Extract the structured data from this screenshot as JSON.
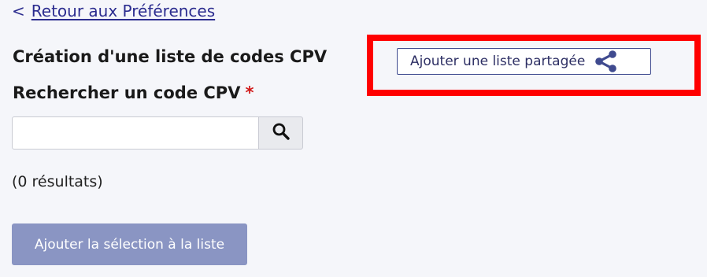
{
  "nav": {
    "back_chevron": "<",
    "back_label": "Retour aux Préférences"
  },
  "page": {
    "heading": "Création d'une liste de codes CPV"
  },
  "shared_list_button": {
    "label": "Ajouter une liste partagée",
    "icon": "share-icon"
  },
  "search": {
    "label": "Rechercher un code CPV",
    "required_mark": "*",
    "value": "",
    "placeholder": "",
    "button_icon": "search-icon"
  },
  "results": {
    "text": "(0 résultats)"
  },
  "actions": {
    "add_selection_label": "Ajouter la sélection à la liste"
  },
  "colors": {
    "background": "#f5f6fa",
    "link": "#2b2c8f",
    "highlight": "#ff0000",
    "primary_disabled": "#8a95c3",
    "required": "#d11a1a"
  }
}
